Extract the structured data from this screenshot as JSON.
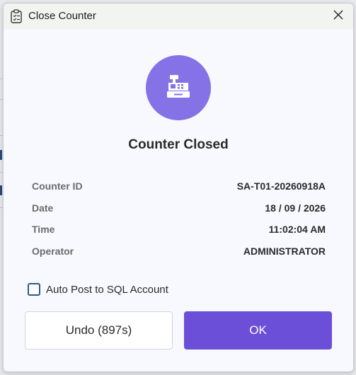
{
  "window": {
    "title": "Close Counter"
  },
  "status": {
    "title": "Counter Closed"
  },
  "details": [
    {
      "label": "Counter ID",
      "value": "SA-T01-20260918A"
    },
    {
      "label": "Date",
      "value": "18 / 09 / 2026"
    },
    {
      "label": "Time",
      "value": "11:02:04 AM"
    },
    {
      "label": "Operator",
      "value": "ADMINISTRATOR"
    }
  ],
  "options": {
    "auto_post_label": "Auto Post to SQL Account",
    "auto_post_checked": false
  },
  "buttons": {
    "undo_label": "Undo (897s)",
    "ok_label": "OK"
  },
  "colors": {
    "accent": "#6b4fd8",
    "badge": "#8472e6",
    "checkbox_border": "#2c5a8c"
  },
  "icons": {
    "title": "clipboard-icon",
    "close": "close-icon",
    "badge": "cash-register-icon"
  }
}
